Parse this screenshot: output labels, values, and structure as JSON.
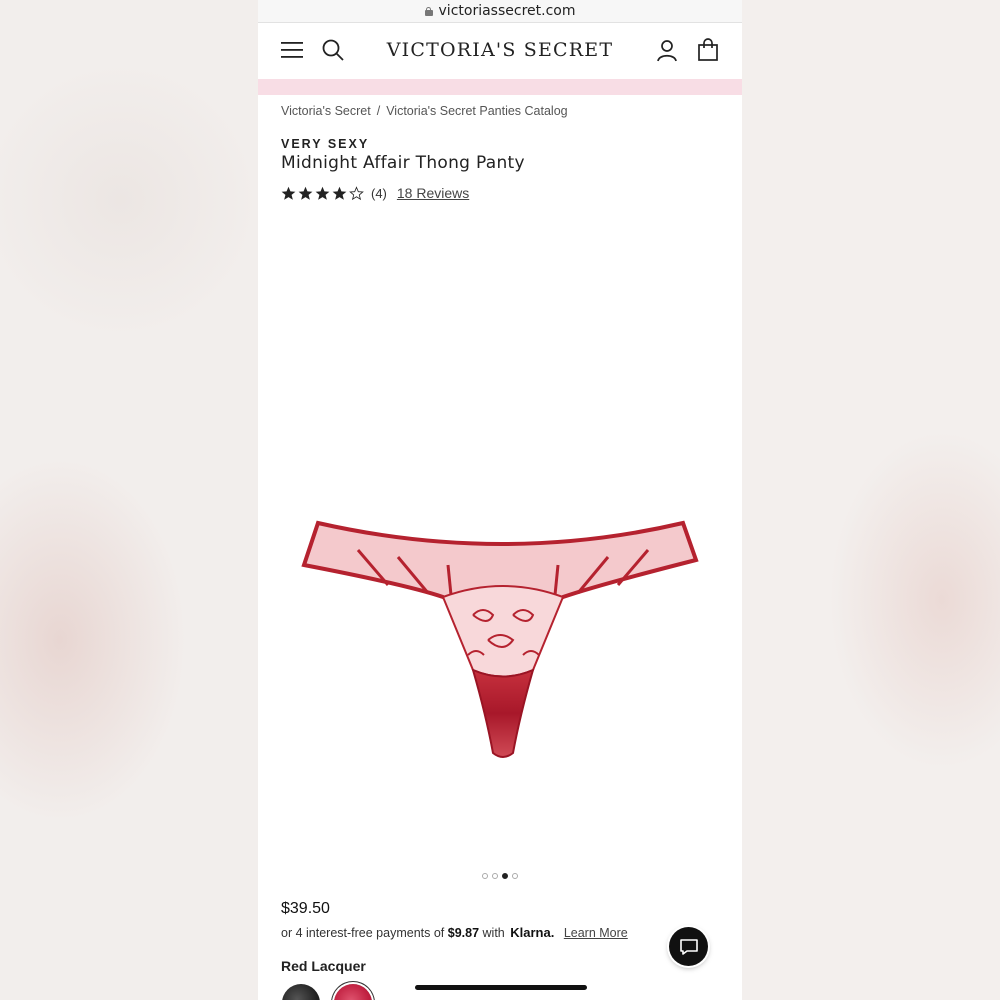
{
  "browser": {
    "url": "victoriassecret.com"
  },
  "header": {
    "logo": "VICTORIA'S SECRET",
    "menu_icon": "hamburger-menu-icon",
    "search_icon": "search-icon",
    "account_icon": "account-icon",
    "bag_icon": "shopping-bag-icon"
  },
  "breadcrumb": {
    "items": [
      "Victoria's Secret",
      "Victoria's Secret Panties Catalog"
    ],
    "separator": "/"
  },
  "product": {
    "collection": "VERY SEXY",
    "name": "Midnight Affair Thong Panty",
    "rating": {
      "stars": 4,
      "max": 5,
      "count_label": "(4)",
      "reviews_label": "18 Reviews"
    },
    "image_carousel": {
      "total": 4,
      "active_index": 2
    },
    "price": "$39.50",
    "klarna": {
      "prefix": "or 4 interest-free payments of",
      "amount": "$9.87",
      "with": "with",
      "brand": "Klarna.",
      "learn_more": "Learn More"
    },
    "color": {
      "selected_label": "Red Lacquer"
    }
  },
  "colors": {
    "accent_pink": "#f8dde5",
    "product_red": "#b5222f"
  },
  "chat_icon": "chat-icon"
}
